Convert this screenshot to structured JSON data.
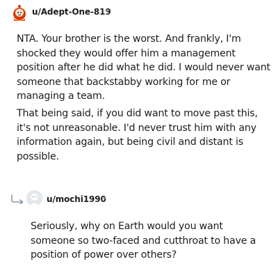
{
  "comments": [
    {
      "username": "u/Adept-One-819",
      "separator": "•",
      "paragraphs": [
        "NTA. Your brother is the worst. And frankly, I'm shocked they would offer him a management position after he did what he did. I would never want someone that backstabby working for me or managing a team.",
        "That being said, if you did want to move past this, it's not unreasonable. I'd never trust him with any information again, but being civil and distant is possible."
      ]
    },
    {
      "username": "u/mochi1990",
      "separator": "•",
      "paragraphs": [
        "Seriously, why on Earth would you want someone so two-faced and cutthroat to have a position of power over others?"
      ]
    }
  ]
}
